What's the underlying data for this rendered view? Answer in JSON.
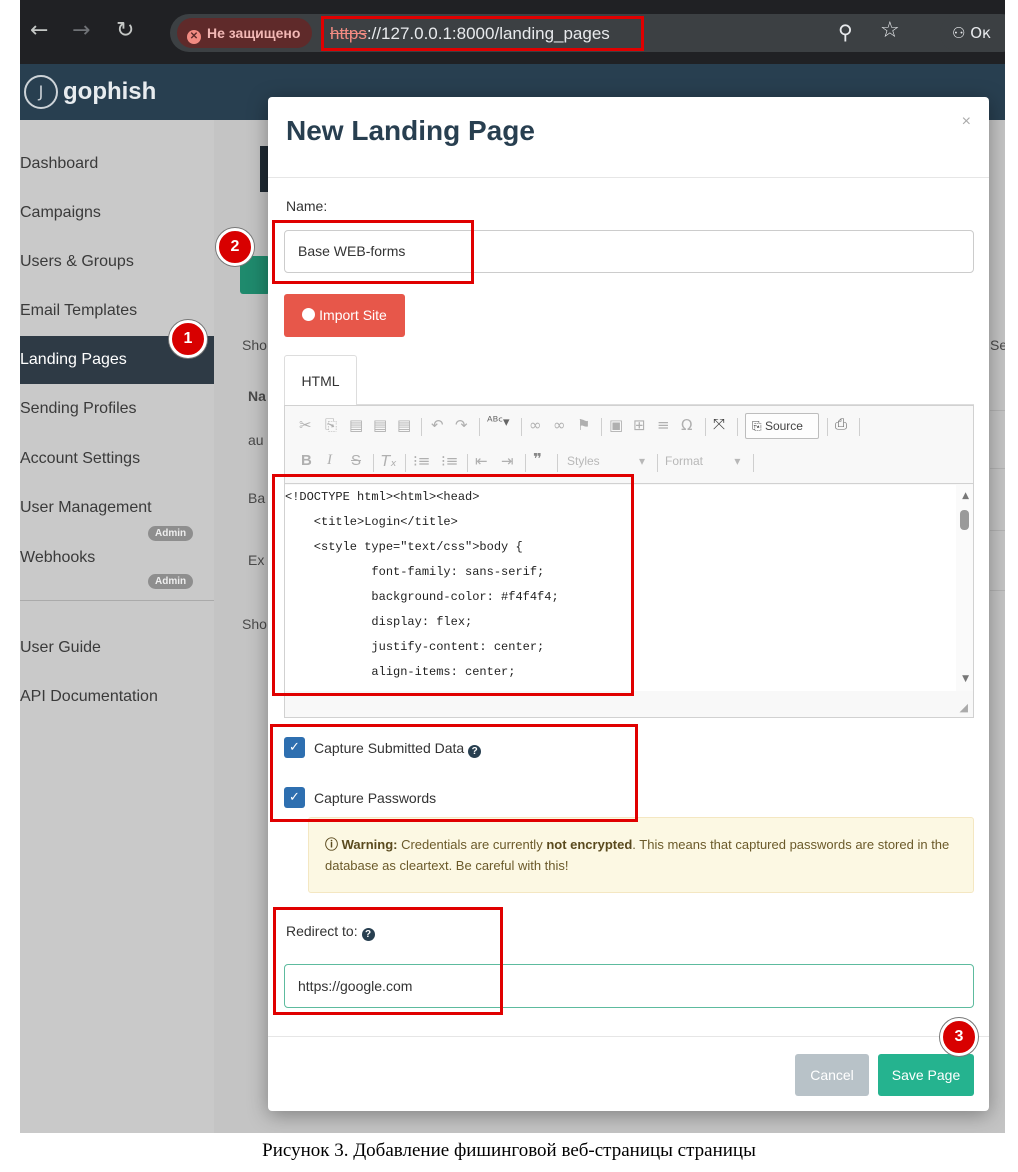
{
  "browser": {
    "back_icon": "arrow-left-icon",
    "insecure_label": "Не защищено",
    "url_scheme": "https",
    "url_rest": "://127.0.0.1:8000/landing_pages",
    "extension_label": "Ок"
  },
  "app": {
    "logo": "gophish"
  },
  "sidebar": {
    "items": [
      {
        "label": "Dashboard"
      },
      {
        "label": "Campaigns"
      },
      {
        "label": "Users & Groups"
      },
      {
        "label": "Email Templates"
      },
      {
        "label": "Landing Pages"
      },
      {
        "label": "Sending Profiles"
      },
      {
        "label": "Account Settings"
      },
      {
        "label": "User Management"
      },
      {
        "label": "Webhooks"
      },
      {
        "label": "User Guide"
      },
      {
        "label": "API Documentation"
      }
    ],
    "badge": "Admin"
  },
  "background": {
    "show_1": "Sho",
    "name_col": "Na",
    "row1": "au",
    "row2": "Ba",
    "row3": "Ex",
    "show_2": "Sho",
    "search_fragment": "Se"
  },
  "modal": {
    "title": "New Landing Page",
    "close": "×",
    "name_label": "Name:",
    "name_value": "Base WEB-forms",
    "import_button": "Import Site",
    "tab_html": "HTML",
    "toolbar": {
      "source": "Source",
      "styles": "Styles",
      "format": "Format"
    },
    "code_lines": [
      "<!DOCTYPE html><html><head>",
      "    <title>Login</title>",
      "    <style type=\"text/css\">body {",
      "            font-family: sans-serif;",
      "            background-color: #f4f4f4;",
      "            display: flex;",
      "            justify-content: center;",
      "            align-items: center;"
    ],
    "capture_data_label": "Capture Submitted Data",
    "capture_passwords_label": "Capture Passwords",
    "warning": {
      "prefix": "Warning:",
      "text_1": " Credentials are currently ",
      "bold": "not encrypted",
      "text_2": ". This means that captured passwords are stored in the database as cleartext. Be careful with this!"
    },
    "redirect_label": "Redirect to:",
    "redirect_value": "https://google.com",
    "cancel_button": "Cancel",
    "save_button": "Save Page"
  },
  "annotations": {
    "marker_1": "1",
    "marker_2": "2",
    "marker_3": "3",
    "highlight_color": "#e00000"
  },
  "caption": "Рисунок 3. Добавление фишинговой веб-страницы страницы"
}
